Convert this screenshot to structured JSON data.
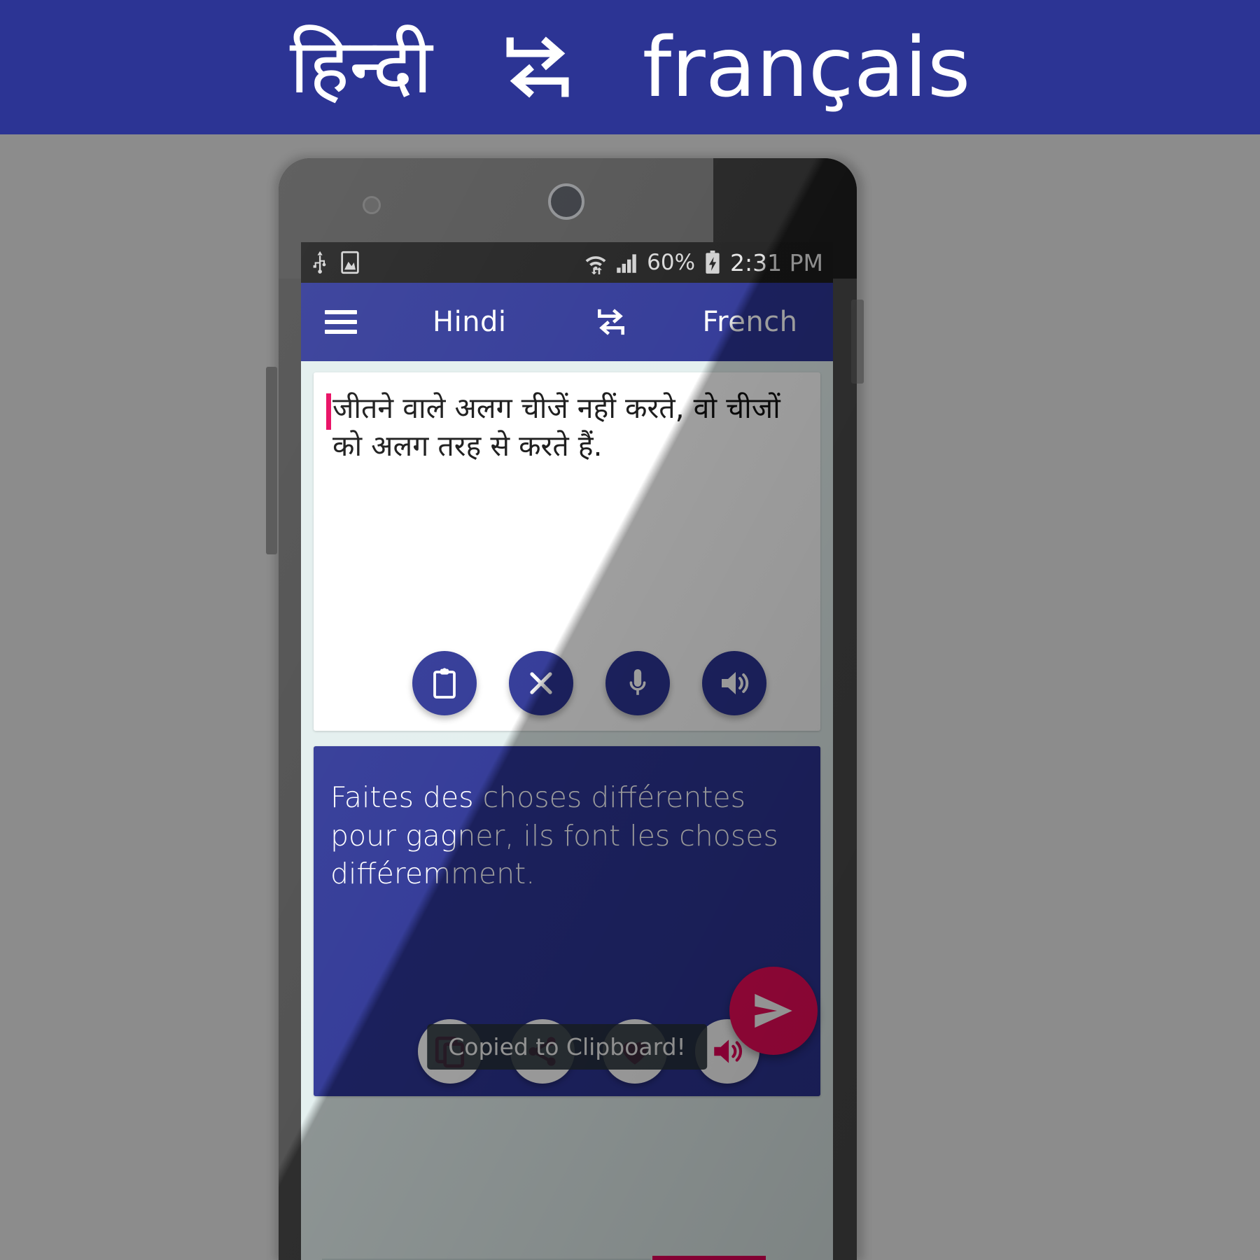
{
  "banner": {
    "source_language": "हिन्दी",
    "swap_icon": "swap-repeat-icon",
    "target_language": "français",
    "background_color": "#2c3494"
  },
  "phone": {
    "status_bar": {
      "left_icons": [
        "usb-icon",
        "screenshot-image-icon"
      ],
      "wifi_icon": "wifi-updown-icon",
      "signal_icon": "cellular-signal-icon",
      "battery_percent": "60%",
      "battery_icon": "battery-charging-icon",
      "time": "2:31 PM",
      "background_color": "#1c1c1c"
    },
    "toolbar": {
      "menu_icon": "hamburger-menu-icon",
      "source_language": "Hindi",
      "swap_icon": "swap-repeat-icon",
      "target_language": "French",
      "background_color": "#2c3494"
    },
    "source_panel": {
      "text": "जीतने वाले अलग चीजें नहीं करते, वो चीजों को  अलग तरह से करते हैं.",
      "caret_color": "#e8005a",
      "background_color": "#ffffff",
      "actions": [
        {
          "name": "paste-button",
          "icon": "clipboard-icon"
        },
        {
          "name": "clear-button",
          "icon": "close-x-icon"
        },
        {
          "name": "voice-input-button",
          "icon": "microphone-icon"
        },
        {
          "name": "speak-source-button",
          "icon": "speaker-volume-icon"
        }
      ]
    },
    "translate_button": {
      "icon": "send-paper-plane-icon",
      "color": "#ee0a5a"
    },
    "result_panel": {
      "text": "Faites des choses différentes pour gagner, ils font les choses différemment.",
      "background_color": "#2c3494",
      "actions": [
        {
          "name": "copy-button",
          "icon": "copy-icon"
        },
        {
          "name": "share-button",
          "icon": "share-icon"
        },
        {
          "name": "favorite-button",
          "icon": "heart-icon"
        },
        {
          "name": "speak-result-button",
          "icon": "speaker-volume-icon"
        }
      ],
      "icon_color": "#e8005a"
    },
    "toast": {
      "message": "Copied to Clipboard!"
    }
  }
}
